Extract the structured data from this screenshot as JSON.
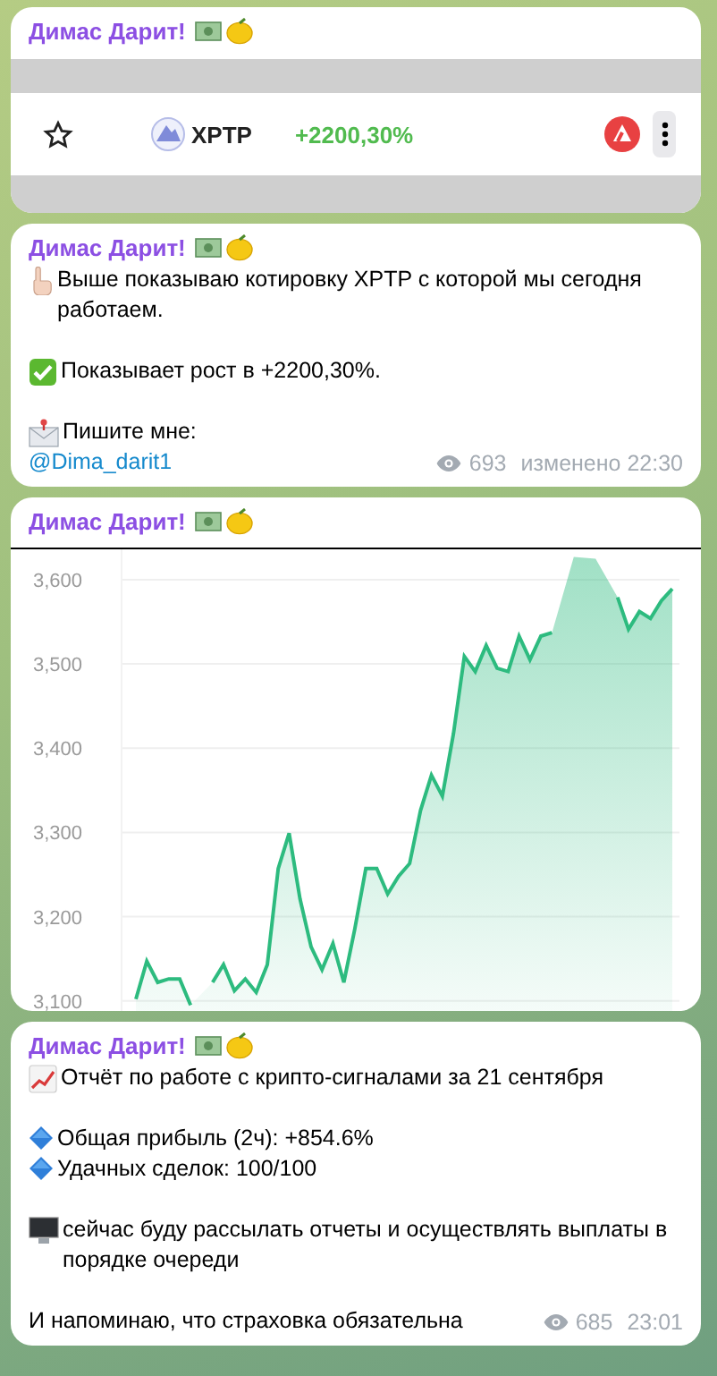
{
  "messages": [
    {
      "kind": "quote-row",
      "sender": "Димас Дарит!",
      "row": {
        "ticker": "XPTP",
        "change": "+2200,30%"
      }
    },
    {
      "kind": "text",
      "sender": "Димас Дарит!",
      "paragraphs": [
        {
          "lines": [
            {
              "kind": "pointer",
              "text": "Выше показываю котировку XPTP с которой мы сегодня работаем."
            }
          ]
        },
        {
          "lines": [
            {
              "kind": "check",
              "text": "Показывает рост в +2200,30%."
            }
          ]
        },
        {
          "lines": [
            {
              "kind": "mail",
              "text": "Пишите мне:"
            },
            {
              "kind": "link",
              "text": "@Dima_darit1"
            }
          ]
        }
      ],
      "views": "693",
      "time": "изменено 22:30"
    },
    {
      "kind": "chart",
      "sender": "Димас Дарит!",
      "chart_data": {
        "type": "area",
        "grid": true,
        "ylim": [
          3088,
          3636
        ],
        "yticks": [
          {
            "value": 3100,
            "label": "3,100"
          },
          {
            "value": 3200,
            "label": "3,200"
          },
          {
            "value": 3300,
            "label": "3,300"
          },
          {
            "value": 3400,
            "label": "3,400"
          },
          {
            "value": 3500,
            "label": "3,500"
          },
          {
            "value": 3600,
            "label": "3,600"
          }
        ],
        "series": [
          {
            "color": "#2dbb7f",
            "values": [
              3102,
              3147,
              3122,
              3126,
              3126,
              3095,
              null,
              3122,
              3143,
              3112,
              3126,
              3110,
              3143,
              3257,
              3299,
              3221,
              3164,
              3137,
              3168,
              3122,
              3185,
              3257,
              3257,
              3227,
              3248,
              3263,
              3326,
              3368,
              3343,
              3417,
              3509,
              3491,
              3522,
              3495,
              3491,
              3533,
              3505,
              3533,
              3537,
              null,
              3627,
              null,
              3625,
              null,
              3579,
              3541,
              3562,
              3554,
              3575,
              3589
            ]
          }
        ]
      }
    },
    {
      "kind": "text",
      "sender": "Димас Дарит!",
      "paragraphs": [
        {
          "lines": [
            {
              "kind": "chart",
              "text": "Отчёт по работе с крипто-сигналами за 21 сентября"
            }
          ]
        },
        {
          "lines": [
            {
              "kind": "diamond",
              "text": "Общая прибыль (2ч): +854.6%"
            },
            {
              "kind": "diamond",
              "text": "Удачных сделок: 100/100"
            }
          ]
        },
        {
          "lines": [
            {
              "kind": "monitor",
              "text": "сейчас буду рассылать отчеты и осуществлять выплаты в порядке очереди"
            }
          ]
        },
        {
          "lines": [
            {
              "kind": "plain",
              "text": "И напоминаю, что страховка обязательна"
            }
          ]
        }
      ],
      "views": "685",
      "time": "23:01"
    }
  ]
}
